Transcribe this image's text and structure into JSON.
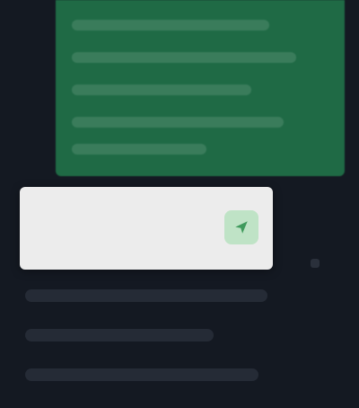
{
  "bubble": {
    "text": ""
  },
  "composer": {
    "placeholder": "",
    "value": "",
    "send_icon": "send-icon"
  },
  "rows": [
    {
      "label": ""
    },
    {
      "label": ""
    },
    {
      "label": ""
    }
  ],
  "colors": {
    "background": "#141922",
    "bubble": "#1f6a45",
    "composer": "#ececec",
    "send_button": "#bfe3c6"
  }
}
